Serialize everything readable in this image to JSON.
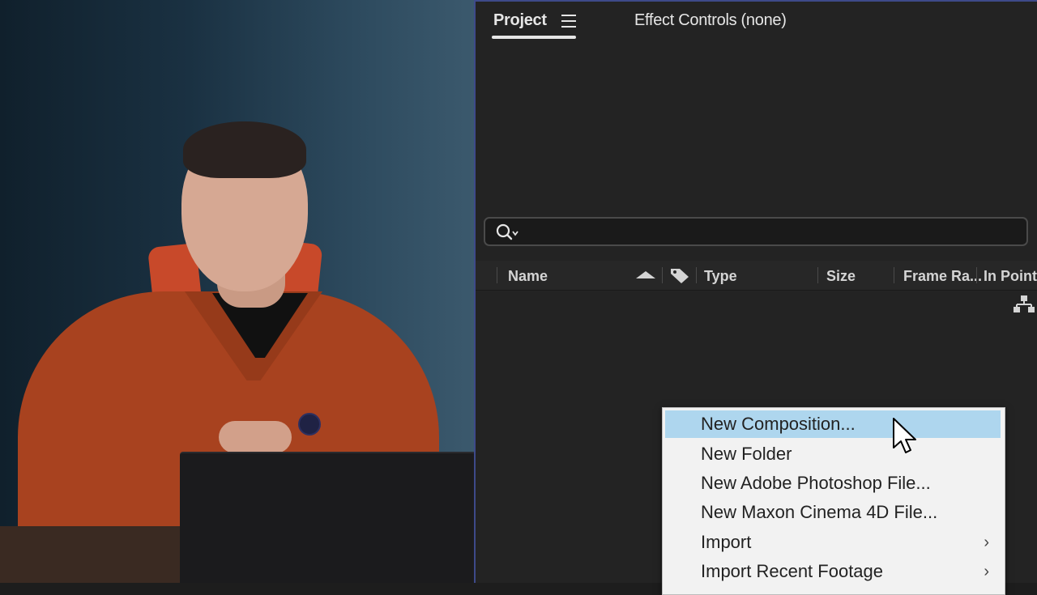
{
  "project_panel": {
    "tabs": [
      {
        "label": "Project",
        "active": true
      },
      {
        "label": "Effect Controls (none)",
        "active": false
      }
    ],
    "search": {
      "value": "",
      "placeholder": ""
    },
    "columns": [
      "Name",
      "Type",
      "Size",
      "Frame Ra...",
      "In Point"
    ],
    "icons": [
      "panel-menu-icon",
      "search-icon",
      "sort-ascending-icon",
      "label-tag-icon",
      "flowchart-icon"
    ]
  },
  "context_menu": {
    "items": [
      {
        "label": "New Composition...",
        "highlighted": true,
        "has_submenu": false
      },
      {
        "label": "New Folder",
        "highlighted": false,
        "has_submenu": false
      },
      {
        "label": "New Adobe Photoshop File...",
        "highlighted": false,
        "has_submenu": false
      },
      {
        "label": "New Maxon Cinema 4D File...",
        "highlighted": false,
        "has_submenu": false
      },
      {
        "label": "Import",
        "highlighted": false,
        "has_submenu": true
      },
      {
        "label": "Import Recent Footage",
        "highlighted": false,
        "has_submenu": true
      }
    ],
    "submenu_arrow": "›"
  },
  "colors": {
    "panel_bg": "#232323",
    "panel_border_accent": "#3e4a8a",
    "menu_bg": "#f2f2f2",
    "menu_highlight": "#aed6ee"
  }
}
